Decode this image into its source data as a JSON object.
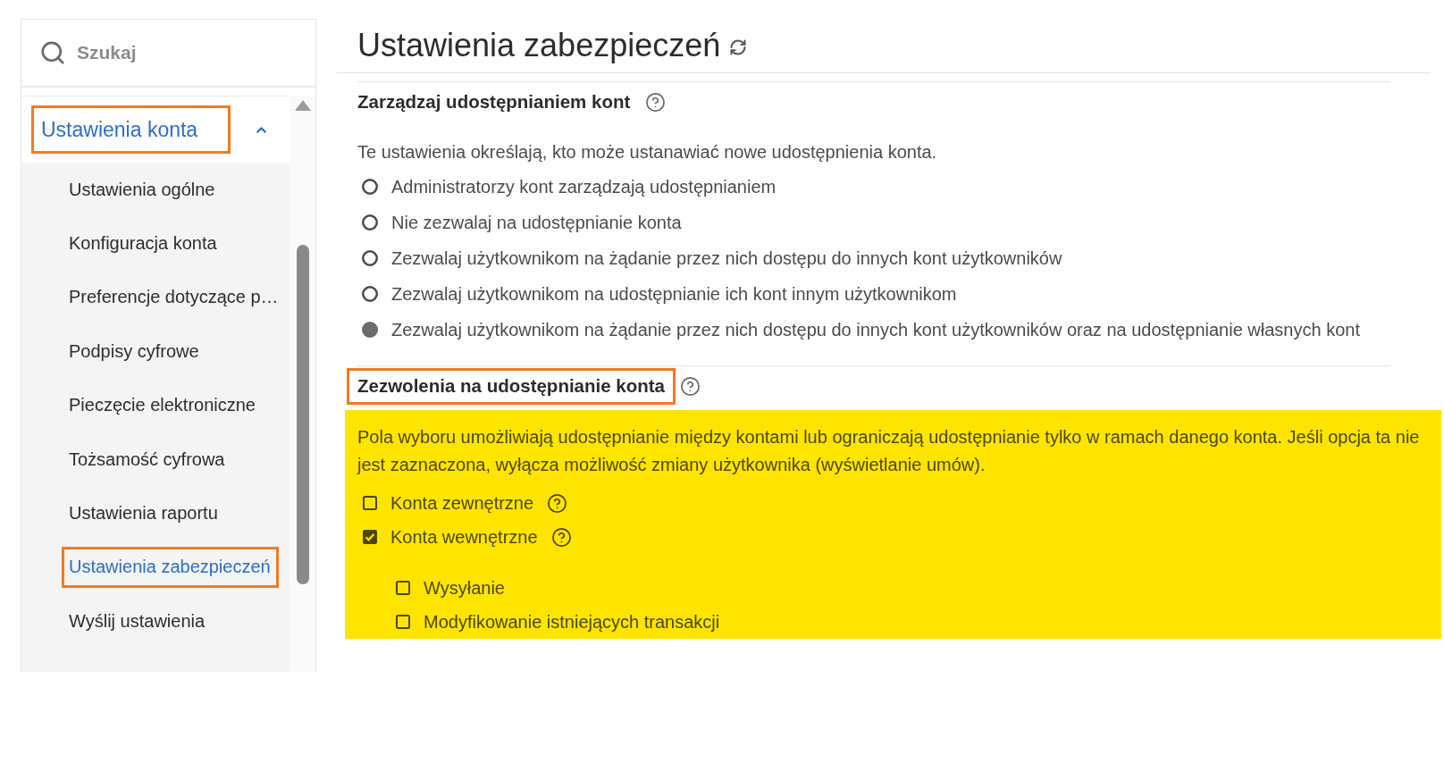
{
  "sidebar": {
    "search": {
      "placeholder": "Szukaj"
    },
    "group": {
      "label": "Ustawienia konta",
      "expanded": true,
      "annotated": true,
      "items": [
        {
          "label": "Ustawienia ogólne",
          "selected": false,
          "annotated": false
        },
        {
          "label": "Konfiguracja konta",
          "selected": false,
          "annotated": false
        },
        {
          "label": "Preferencje dotyczące p…",
          "selected": false,
          "annotated": false
        },
        {
          "label": "Podpisy cyfrowe",
          "selected": false,
          "annotated": false
        },
        {
          "label": "Pieczęcie elektroniczne",
          "selected": false,
          "annotated": false
        },
        {
          "label": "Tożsamość cyfrowa",
          "selected": false,
          "annotated": false
        },
        {
          "label": "Ustawienia raportu",
          "selected": false,
          "annotated": false
        },
        {
          "label": "Ustawienia zabezpieczeń",
          "selected": true,
          "annotated": true
        },
        {
          "label": "Wyślij ustawienia",
          "selected": false,
          "annotated": false
        }
      ]
    }
  },
  "page": {
    "title": "Ustawienia zabezpieczeń"
  },
  "sections": [
    {
      "title": "Zarządzaj udostępnianiem kont",
      "help": true,
      "annotated": false,
      "highlighted": false,
      "description": "Te ustawienia określają, kto może ustanawiać nowe udostępnienia konta.",
      "options": [
        {
          "kind": "radio",
          "label": "Administratorzy kont zarządzają udostępnianiem",
          "selected": false
        },
        {
          "kind": "radio",
          "label": "Nie zezwalaj na udostępnianie konta",
          "selected": false
        },
        {
          "kind": "radio",
          "label": "Zezwalaj użytkownikom na żądanie przez nich dostępu do innych kont użytkowników",
          "selected": false
        },
        {
          "kind": "radio",
          "label": "Zezwalaj użytkownikom na udostępnianie ich kont innym użytkownikom",
          "selected": false
        },
        {
          "kind": "radio",
          "label": "Zezwalaj użytkownikom na żądanie przez nich dostępu do innych kont użytkowników oraz na udostępnianie własnych kont",
          "selected": true
        }
      ]
    },
    {
      "title": "Zezwolenia na udostępnianie konta",
      "help": true,
      "annotated": true,
      "highlighted": true,
      "description": "Pola wyboru umożliwiają udostępnianie między kontami lub ograniczają udostępnianie tylko w ramach danego konta. Jeśli opcja ta nie jest zaznaczona, wyłącza możliwość zmiany użytkownika (wyświetlanie umów).",
      "options": [
        {
          "kind": "checkbox",
          "label": "Konta zewnętrzne",
          "checked": false,
          "help": true
        },
        {
          "kind": "checkbox",
          "label": "Konta wewnętrzne",
          "checked": true,
          "help": true,
          "children": [
            {
              "kind": "checkbox",
              "label": "Wysyłanie",
              "checked": false,
              "help": false
            },
            {
              "kind": "checkbox",
              "label": "Modyfikowanie istniejących transakcji",
              "checked": false,
              "help": false
            }
          ]
        }
      ]
    }
  ]
}
